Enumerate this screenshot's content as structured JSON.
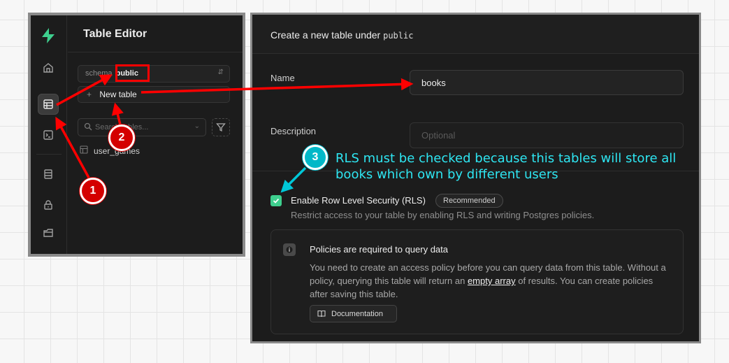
{
  "sidebar": {
    "title": "Table Editor",
    "schema_label": "schema",
    "schema_value": "public",
    "new_table_label": "New table",
    "search_placeholder": "Search tables...",
    "tables": [
      "user_games"
    ],
    "icons": [
      "supabase-logo-icon",
      "home-icon",
      "table-editor-icon",
      "sql-editor-icon",
      "database-icon",
      "auth-lock-icon",
      "storage-icon"
    ]
  },
  "form": {
    "header_prefix": "Create a new table under",
    "header_schema": "public",
    "name_label": "Name",
    "name_value": "books",
    "description_label": "Description",
    "description_placeholder": "Optional",
    "rls_label": "Enable Row Level Security (RLS)",
    "rls_checked": true,
    "rls_badge": "Recommended",
    "rls_description": "Restrict access to your table by enabling RLS and writing Postgres policies.",
    "policy": {
      "title": "Policies are required to query data",
      "body_part1": "You need to create an access policy before you can query data from this table. Without a policy, querying this table will return an",
      "body_link": "empty array",
      "body_part2": "of results. You can create policies after saving this table.",
      "doc_button": "Documentation"
    }
  },
  "annotations": {
    "step1": "1",
    "step2": "2",
    "step3": "3",
    "note3": "RLS must be checked because this tables will store all books which own by different users",
    "arrow_color": "#ff0000",
    "note_color": "#2ee6f2"
  },
  "colors": {
    "panel_bg": "#1c1c1c",
    "accent_green": "#3ecf8e"
  }
}
